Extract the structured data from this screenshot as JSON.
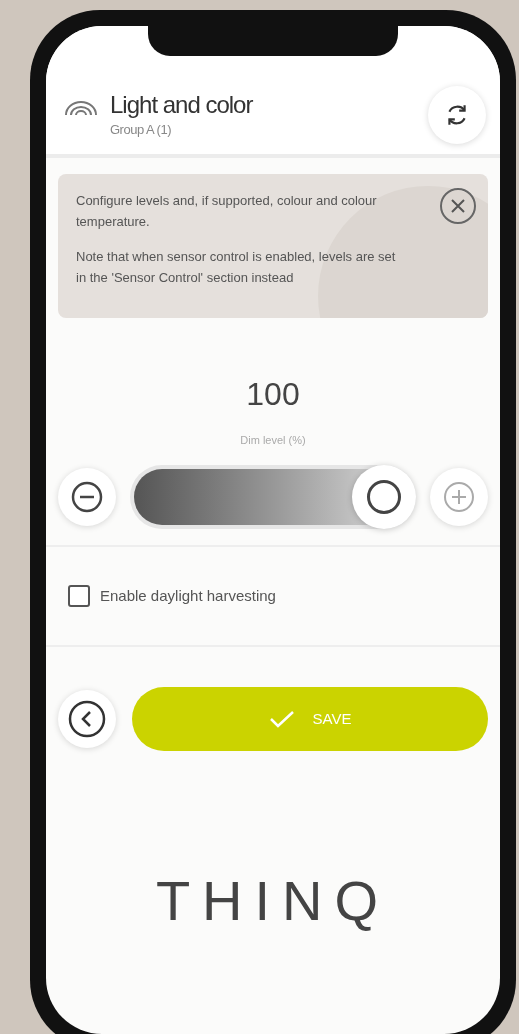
{
  "header": {
    "title": "Light and color",
    "subtitle": "Group A (1)"
  },
  "info": {
    "paragraphs": [
      "Configure levels and, if supported, colour and colour temperature.",
      "Note that when sensor control is enabled, levels are set in the 'Sensor Control' section instead"
    ]
  },
  "dimmer": {
    "value": "100",
    "label": "Dim level (%)",
    "level": 1.0
  },
  "options": [
    {
      "label": "Enable daylight harvesting",
      "checked": false
    }
  ],
  "save_button": {
    "label": "SAVE"
  },
  "logo": "THINQ"
}
